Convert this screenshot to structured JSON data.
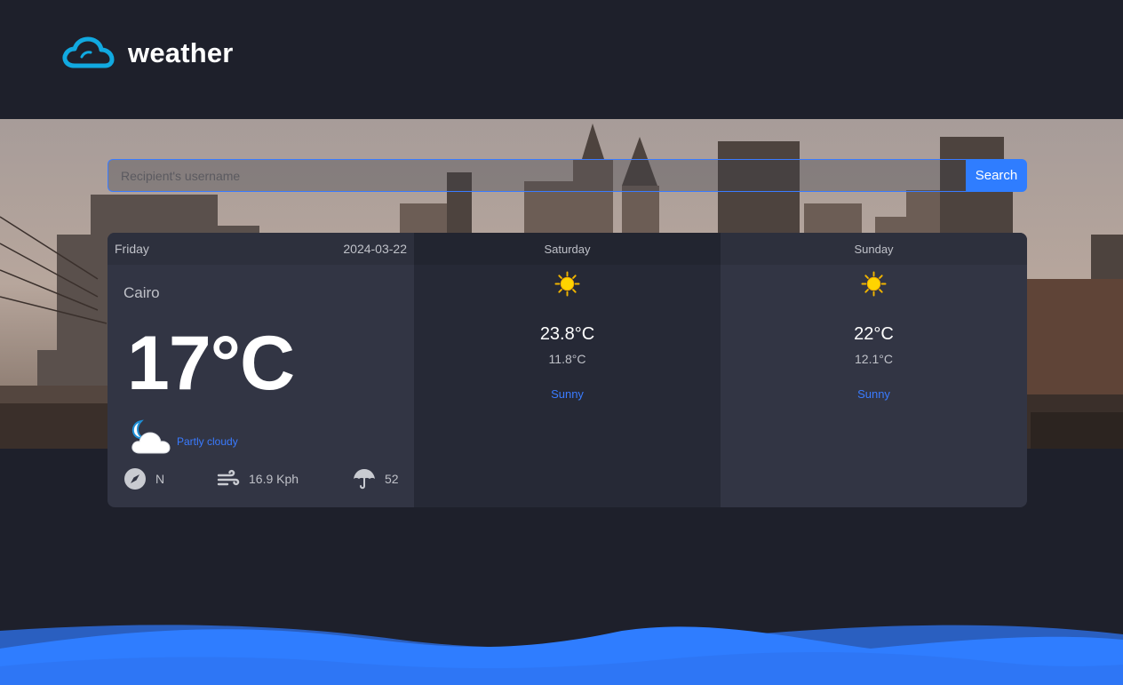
{
  "brand": {
    "name": "weather"
  },
  "search": {
    "placeholder": "Recipient's username",
    "button_label": "Search"
  },
  "today": {
    "day": "Friday",
    "date": "2024-03-22",
    "city": "Cairo",
    "temp": "17°C",
    "condition": "Partly cloudy",
    "condition_icon": "partly-cloudy-night-icon",
    "wind_direction": "N",
    "wind_speed": "16.9 Kph",
    "humidity": "52"
  },
  "forecast": [
    {
      "day": "Saturday",
      "max": "23.8°C",
      "min": "11.8°C",
      "condition": "Sunny",
      "icon": "sun-icon"
    },
    {
      "day": "Sunday",
      "max": "22°C",
      "min": "12.1°C",
      "condition": "Sunny",
      "icon": "sun-icon"
    }
  ],
  "colors": {
    "accent": "#2f7dff",
    "background": "#1e202b",
    "card": "#323544",
    "card_alt": "#262936"
  }
}
